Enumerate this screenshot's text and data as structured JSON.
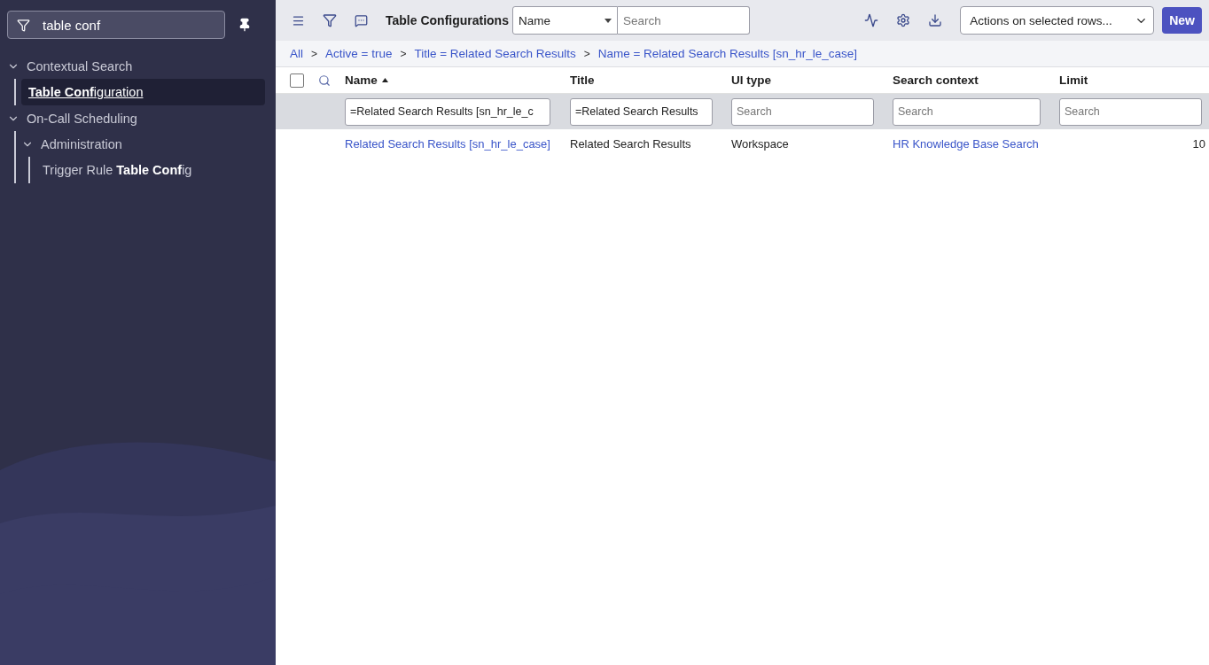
{
  "sidebar": {
    "filter": {
      "value": "table conf"
    },
    "tree": [
      {
        "label": "Contextual Search",
        "expanded": true,
        "children": [
          {
            "label": "**Table Conf**iguration",
            "selected": true
          }
        ]
      },
      {
        "label": "On-Call Scheduling",
        "expanded": true,
        "children": [
          {
            "label": "Administration",
            "expanded": true,
            "children": [
              {
                "label": "Trigger Rule **Table Conf**ig",
                "selected": false
              }
            ]
          }
        ]
      }
    ]
  },
  "header": {
    "title": "Table Configurations",
    "search_field": {
      "value": "Name",
      "placeholder": "Search"
    },
    "actions": {
      "value": "Actions on selected rows..."
    },
    "new_button": "New"
  },
  "breadcrumbs": {
    "separator": ">",
    "items": [
      "All",
      "Active = true",
      "Title = Related Search Results",
      "Name = Related Search Results [sn_hr_le_case]"
    ]
  },
  "table": {
    "select_all": {
      "checked": false
    },
    "columns": [
      {
        "label": "Name",
        "sorted": true
      },
      {
        "label": "Title",
        "sorted": false
      },
      {
        "label": "UI type",
        "sorted": false
      },
      {
        "label": "Search context",
        "sorted": false
      },
      {
        "label": "Limit",
        "sorted": false
      }
    ],
    "filters": [
      {
        "value": "=Related Search Results [sn_hr_le_c"
      },
      {
        "value": "=Related Search Results"
      },
      {
        "placeholder": "Search"
      },
      {
        "placeholder": "Search"
      },
      {
        "placeholder": "Search"
      }
    ],
    "rows": [
      {
        "cells": [
          {
            "text": "Related Search Results [sn_hr_le_case]",
            "kind": "link"
          },
          {
            "text": "Related Search Results",
            "kind": "text"
          },
          {
            "text": "Workspace",
            "kind": "text"
          },
          {
            "text": "HR Knowledge Base Search",
            "kind": "link"
          },
          {
            "text": "10",
            "kind": "number"
          }
        ]
      }
    ]
  }
}
